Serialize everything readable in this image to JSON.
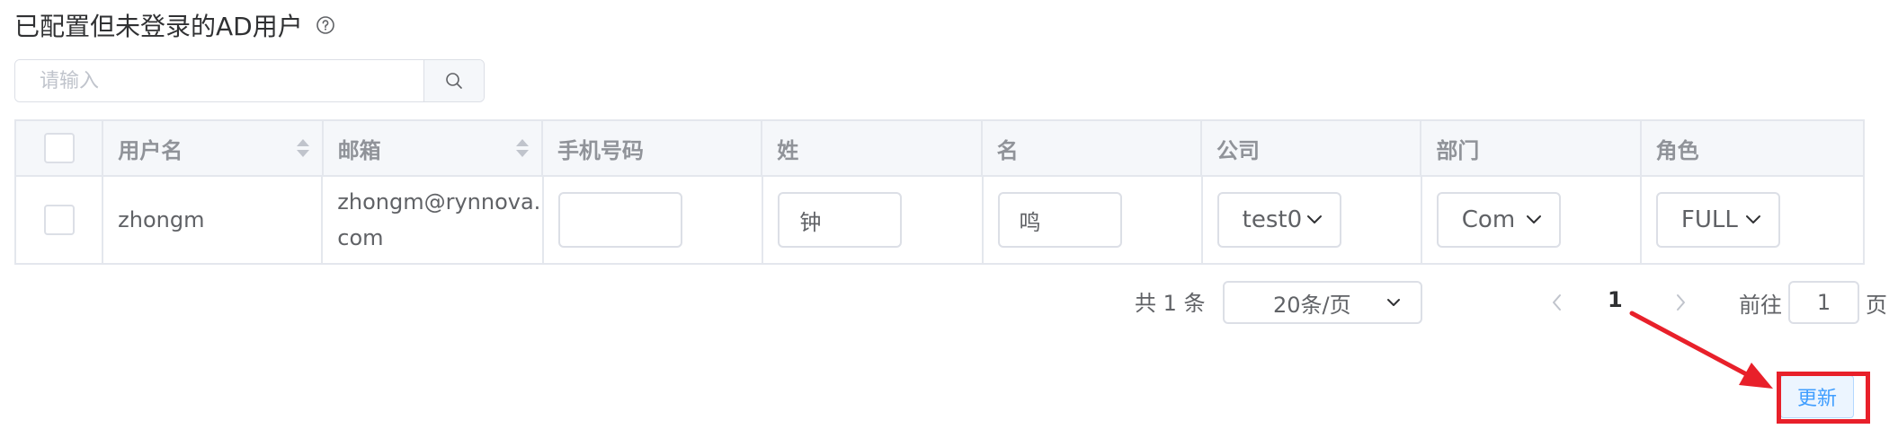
{
  "title": "已配置但未登录的AD用户",
  "icons": {
    "help": "question-circle-icon",
    "search": "search-icon",
    "sort": "sort-caret-icon",
    "dropdown": "chevron-down-icon",
    "prev": "chevron-left-icon",
    "next": "chevron-right-icon"
  },
  "search": {
    "placeholder": "请输入"
  },
  "table": {
    "columns": [
      {
        "label": ""
      },
      {
        "label": "用户名",
        "sortable": true
      },
      {
        "label": "邮箱",
        "sortable": true
      },
      {
        "label": "手机号码"
      },
      {
        "label": "姓"
      },
      {
        "label": "名"
      },
      {
        "label": "公司"
      },
      {
        "label": "部门"
      },
      {
        "label": "角色"
      }
    ],
    "rows": [
      {
        "username": "zhongm",
        "email_line1": "zhongm@rynnova.",
        "email_line2": "com",
        "phone": "",
        "last_name": "钟",
        "first_name": "鸣",
        "company": "test0",
        "department": "Com",
        "role": "FULL"
      }
    ]
  },
  "pagination": {
    "total": "共 1 条",
    "page_size": "20条/页",
    "current_page": "1",
    "goto_label": "前往",
    "goto_value": "1",
    "goto_suffix": "页"
  },
  "update_button": {
    "label": "更新"
  },
  "colors": {
    "primary": "#409eff",
    "annotation": "#e8202a",
    "header_bg": "#f5f7fa",
    "border": "#e4e7ed"
  }
}
